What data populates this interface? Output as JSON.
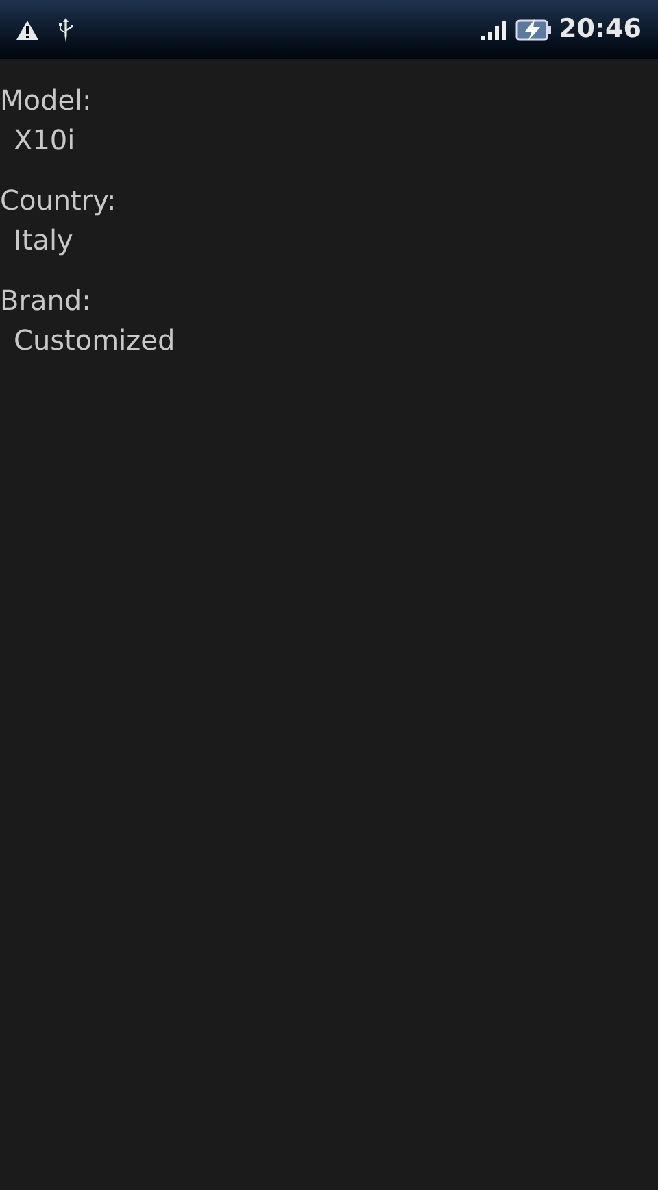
{
  "status_bar": {
    "time": "20:46",
    "charging": true
  },
  "fields": [
    {
      "label": "Model:",
      "value": "X10i"
    },
    {
      "label": "Country:",
      "value": "Italy"
    },
    {
      "label": "Brand:",
      "value": "Customized"
    }
  ]
}
